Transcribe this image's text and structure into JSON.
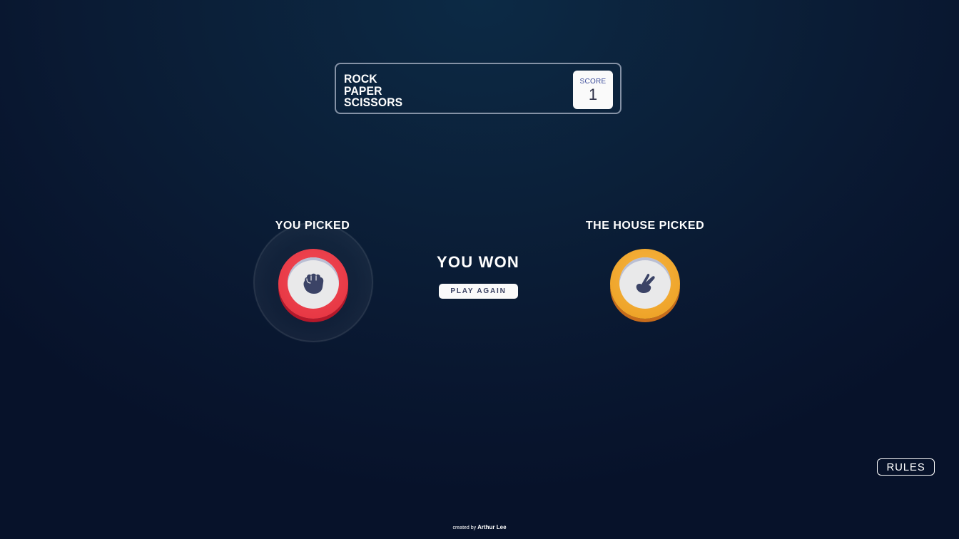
{
  "header": {
    "title_lines": [
      "ROCK",
      "PAPER",
      "SCISSORS"
    ],
    "score_label": "SCORE",
    "score_value": "1"
  },
  "player": {
    "label": "YOU PICKED",
    "choice": "rock",
    "choice_icon": "rock-fist-icon",
    "ring_color": "#e5323f"
  },
  "house": {
    "label": "THE HOUSE PICKED",
    "choice": "scissors",
    "choice_icon": "scissors-hand-icon",
    "ring_color": "#ec9e1f"
  },
  "result": {
    "text": "YOU WON",
    "play_again_label": "PLAY AGAIN"
  },
  "rules_label": "RULES",
  "footer": {
    "prefix": "created by",
    "author": "Arthur Lee"
  },
  "colors": {
    "background": "#0b1f38",
    "icon": "#3b4366"
  }
}
